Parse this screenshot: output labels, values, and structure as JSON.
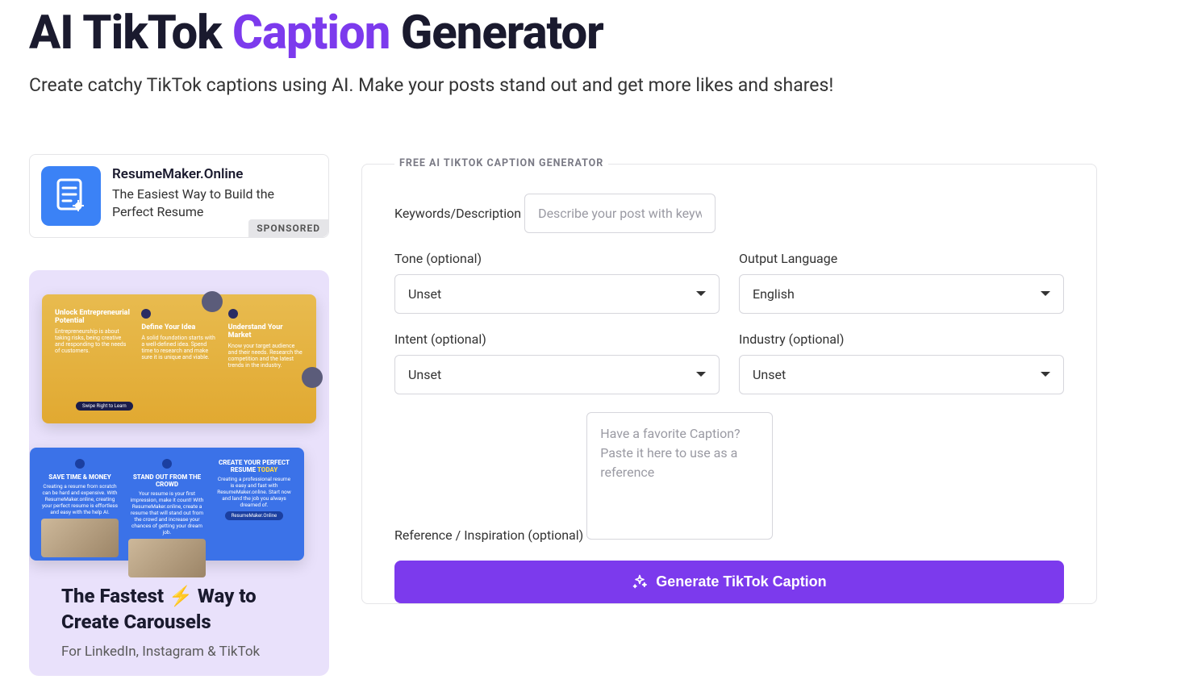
{
  "header": {
    "title_pre": "AI TikTok ",
    "title_accent": "Caption",
    "title_post": " Generator",
    "subtitle": "Create catchy TikTok captions using AI. Make your posts stand out and get more likes and shares!"
  },
  "sponsor": {
    "title": "ResumeMaker.Online",
    "desc": "The Easiest Way to Build the Perfect Resume",
    "badge": "SPONSORED"
  },
  "promo": {
    "title_part1": "The Fastest ",
    "bolt": "⚡",
    "title_part2": " Way to Create Carousels",
    "subtitle": "For LinkedIn, Instagram & TikTok",
    "slide1": {
      "p1_hl": "Unlock Entrepreneurial Potential",
      "p2_hl": "Define Your Idea",
      "p3_hl": "Understand Your Market",
      "pill": "Swipe Right to Learn"
    },
    "slide2": {
      "p1_hl": "SAVE TIME & MONEY",
      "p2_hl": "STAND OUT FROM THE CROWD",
      "p3_hl": "CREATE YOUR PERFECT RESUME ",
      "p3_today": "TODAY",
      "btn": "ResumeMaker.Online"
    }
  },
  "form": {
    "legend": "FREE AI TIKTOK CAPTION GENERATOR",
    "keywords": {
      "label": "Keywords/Description",
      "placeholder": "Describe your post with keywords or in simple words"
    },
    "tone": {
      "label": "Tone (optional)",
      "value": "Unset"
    },
    "language": {
      "label": "Output Language",
      "value": "English"
    },
    "intent": {
      "label": "Intent (optional)",
      "value": "Unset"
    },
    "industry": {
      "label": "Industry (optional)",
      "value": "Unset"
    },
    "reference": {
      "label": "Reference / Inspiration (optional)",
      "placeholder": "Have a favorite Caption? Paste it here to use as a reference"
    },
    "button": "Generate TikTok Caption"
  }
}
